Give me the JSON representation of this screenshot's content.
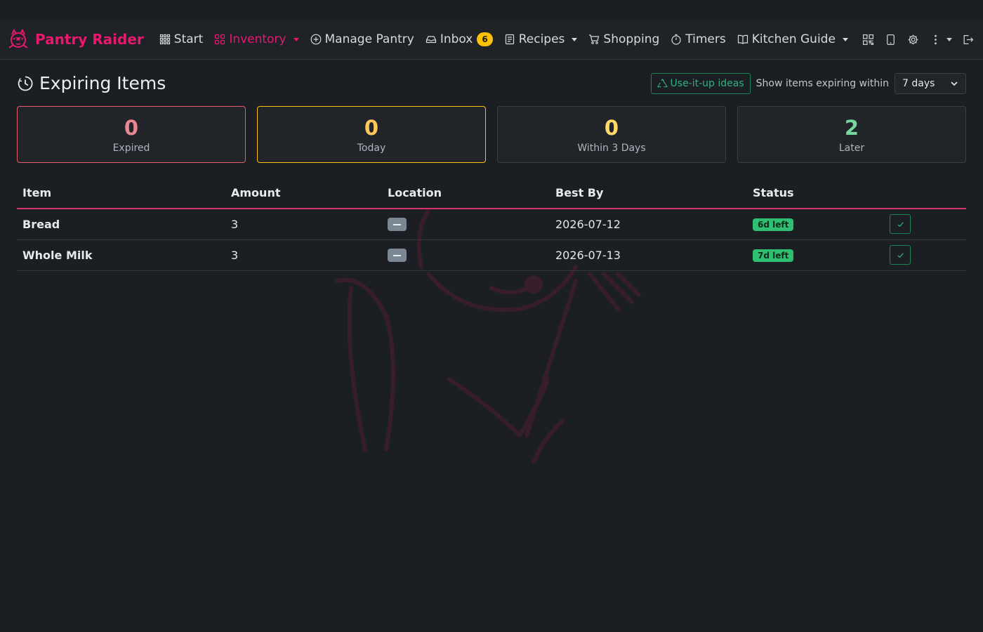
{
  "brand": {
    "name": "Pantry Raider",
    "color": "#e8186d"
  },
  "nav": {
    "items": [
      {
        "label": "Start",
        "icon": "grid-icon"
      },
      {
        "label": "Inventory",
        "icon": "boxes-icon",
        "active": true,
        "dropdown": true
      },
      {
        "label": "Manage Pantry",
        "icon": "plus-circle-icon"
      },
      {
        "label": "Inbox",
        "icon": "inbox-icon",
        "badge": "6"
      },
      {
        "label": "Recipes",
        "icon": "recipe-icon",
        "dropdown": true
      },
      {
        "label": "Shopping",
        "icon": "cart-icon"
      },
      {
        "label": "Timers",
        "icon": "stopwatch-icon"
      },
      {
        "label": "Kitchen Guide",
        "icon": "book-icon",
        "dropdown": true
      }
    ],
    "right_icons": [
      "qr-code-icon",
      "tablet-icon",
      "gear-icon",
      "more-vertical-icon",
      "logout-icon"
    ]
  },
  "page": {
    "title": "Expiring Items",
    "ideas_button": "Use-it-up ideas",
    "within_label": "Show items expiring within",
    "within_value": "7 days"
  },
  "summary": [
    {
      "value": "0",
      "label": "Expired",
      "color": "#ea868f"
    },
    {
      "value": "0",
      "label": "Today",
      "color": "#ffc65c"
    },
    {
      "value": "0",
      "label": "Within 3 Days",
      "color": "#ffda6a"
    },
    {
      "value": "2",
      "label": "Later",
      "color": "#75d6a0"
    }
  ],
  "table": {
    "headers": [
      "Item",
      "Amount",
      "Location",
      "Best By",
      "Status",
      ""
    ],
    "rows": [
      {
        "item": "Bread",
        "amount": "3",
        "best_by": "2026-07-12",
        "status": "6d left"
      },
      {
        "item": "Whole Milk",
        "amount": "3",
        "best_by": "2026-07-13",
        "status": "7d left"
      }
    ]
  }
}
